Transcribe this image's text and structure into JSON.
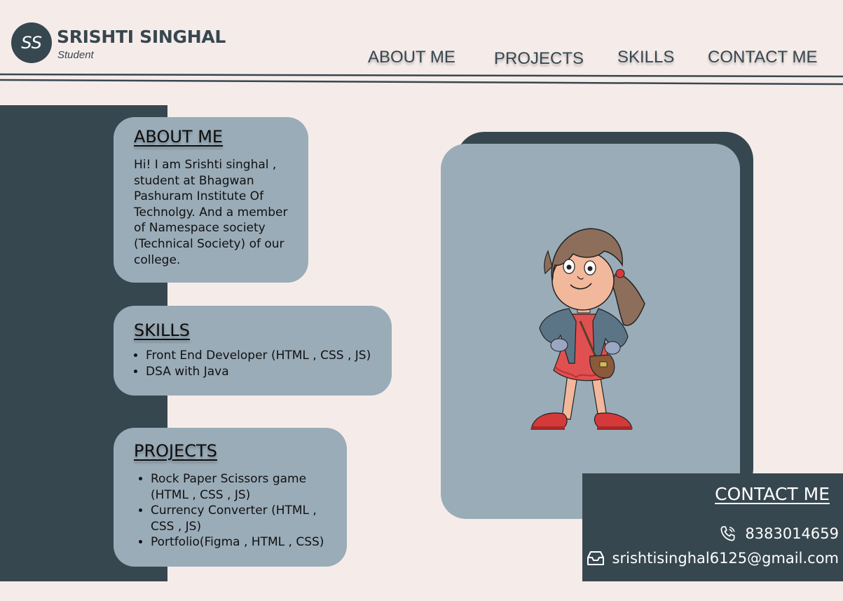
{
  "header": {
    "logo_initials": "SS",
    "name": "SRISHTI SINGHAL",
    "subtitle": "Student",
    "nav": [
      {
        "label": "ABOUT ME"
      },
      {
        "label": "PROJECTS"
      },
      {
        "label": "SKILLS"
      },
      {
        "label": "CONTACT ME"
      }
    ]
  },
  "about": {
    "title": "ABOUT ME",
    "text": "Hi! I am Srishti singhal , student at Bhagwan Pashuram Institute Of Technolgy. And a member of Namespace society (Technical Society) of our college."
  },
  "skills": {
    "title": "SKILLS",
    "items": [
      "Front End Developer (HTML , CSS , JS)",
      "DSA with Java"
    ]
  },
  "projects": {
    "title": "PROJECTS",
    "items": [
      "Rock Paper Scissors game (HTML , CSS , JS)",
      "Currency Converter (HTML , CSS , JS)",
      "Portfolio(Figma , HTML , CSS)"
    ]
  },
  "contact": {
    "title": "CONTACT ME",
    "phone": "8383014659",
    "email": "srishtisinghal6125@gmail.com",
    "phone_icon": "phone-icon",
    "email_icon": "inbox-icon"
  },
  "colors": {
    "background": "#f5ecea",
    "dark": "#37474f",
    "card": "#9aacb8"
  }
}
